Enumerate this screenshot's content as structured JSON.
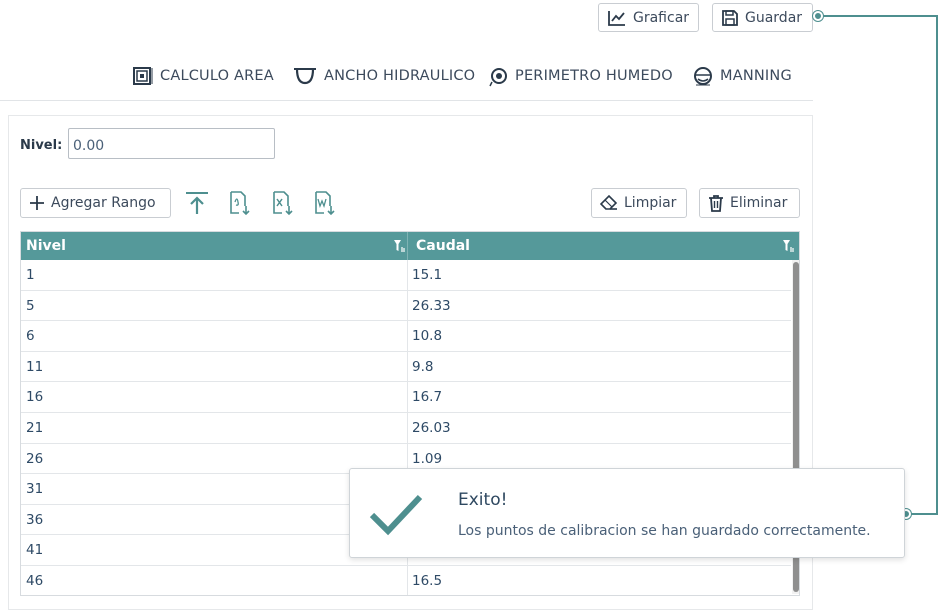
{
  "header": {
    "graficar_label": "Graficar",
    "guardar_label": "Guardar"
  },
  "tools": {
    "area": "CALCULO AREA",
    "ancho": "ANCHO HIDRAULICO",
    "perimetro": "PERIMETRO HUMEDO",
    "manning": "MANNING"
  },
  "form": {
    "nivel_label": "Nivel:",
    "nivel_value": "0.00"
  },
  "actions": {
    "agregar_label": "Agregar Rango",
    "limpiar_label": "Limpiar",
    "eliminar_label": "Eliminar"
  },
  "grid": {
    "columns": [
      "Nivel",
      "Caudal"
    ],
    "rows": [
      [
        "1",
        "15.1"
      ],
      [
        "5",
        "26.33"
      ],
      [
        "6",
        "10.8"
      ],
      [
        "11",
        "9.8"
      ],
      [
        "16",
        "16.7"
      ],
      [
        "21",
        "26.03"
      ],
      [
        "26",
        "1.09"
      ],
      [
        "31",
        ""
      ],
      [
        "36",
        ""
      ],
      [
        "41",
        ""
      ],
      [
        "46",
        "16.5"
      ]
    ]
  },
  "toast": {
    "title": "Exito!",
    "message": "Los puntos de calibracion se han guardado correctamente."
  },
  "colors": {
    "accent": "#55999a",
    "connector": "#4e8f8f",
    "text": "#3c4a5c"
  }
}
